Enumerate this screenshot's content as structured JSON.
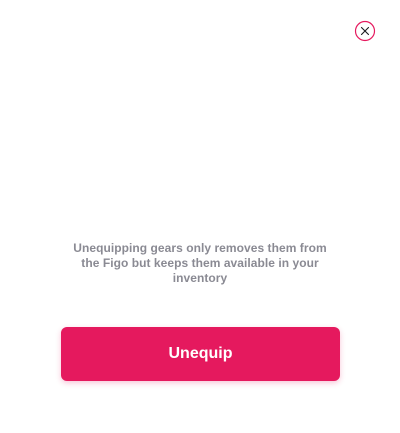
{
  "dialog": {
    "message": "Unequipping gears only removes them from the Figo but keeps them available in your inventory",
    "primary_button_label": "Unequip",
    "close_icon": "close-icon"
  },
  "colors": {
    "accent": "#e5195e",
    "message_text": "#8a8a93",
    "close_icon": "#e5195e",
    "background": "#ffffff"
  }
}
